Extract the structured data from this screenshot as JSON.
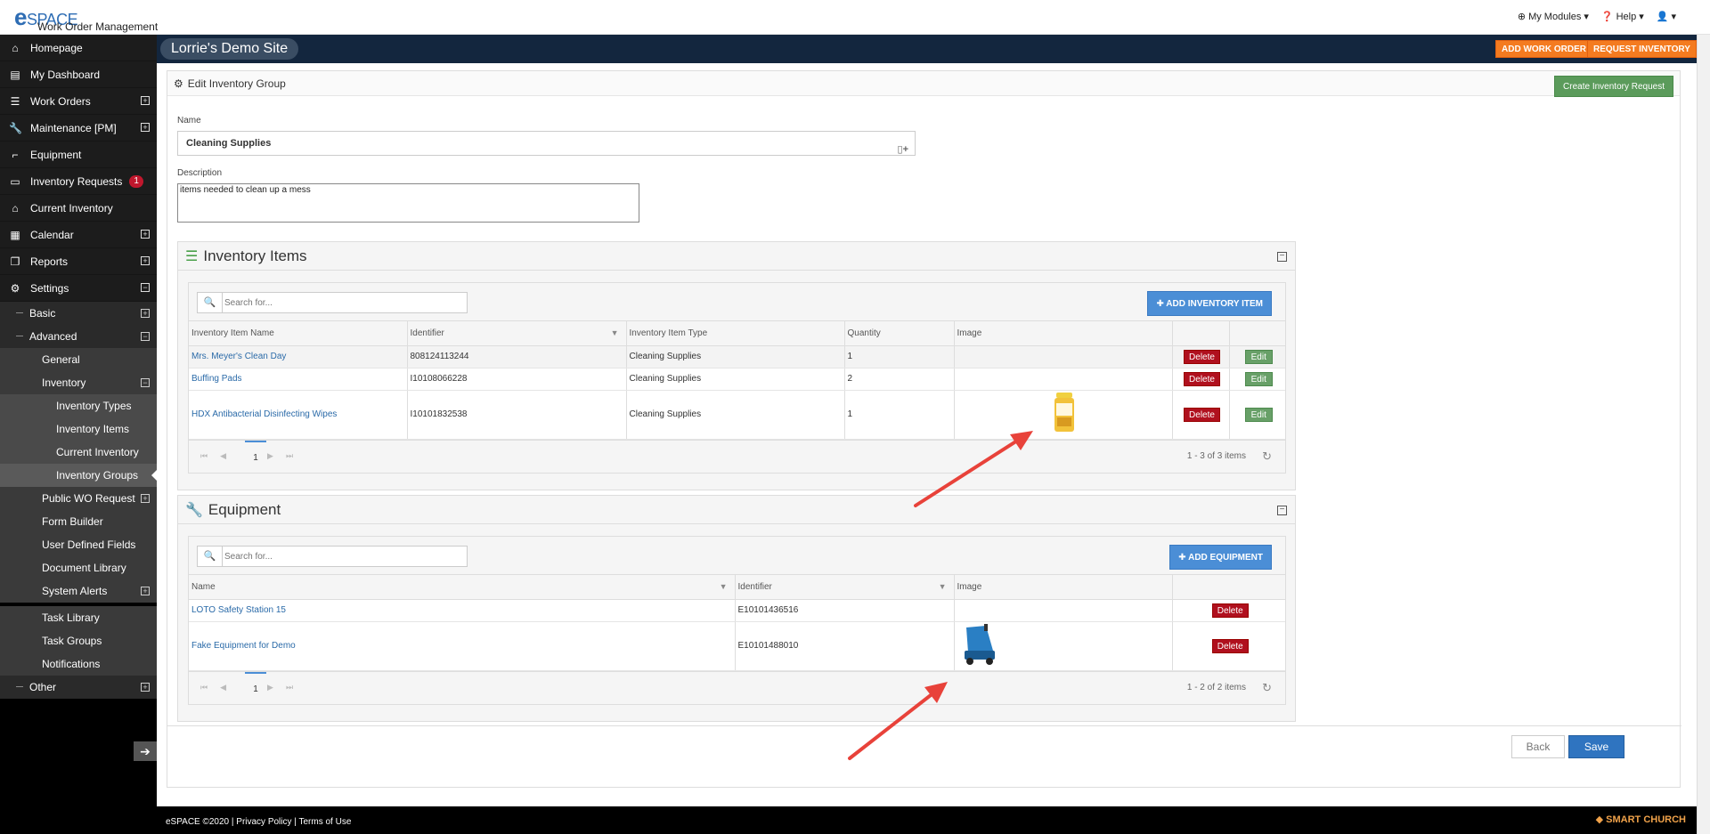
{
  "app": {
    "logo_text": "eSPACE",
    "tagline": "Work Order Management"
  },
  "topnav": {
    "modules": "My Modules",
    "help": "Help",
    "user": ""
  },
  "sidebar": {
    "main": [
      {
        "label": "Homepage",
        "icon": "home-icon"
      },
      {
        "label": "My Dashboard",
        "icon": "dashboard-icon"
      },
      {
        "label": "Work Orders",
        "icon": "list-icon",
        "expand": true
      },
      {
        "label": "Maintenance [PM]",
        "icon": "wrench-icon",
        "expand": true
      },
      {
        "label": "Equipment",
        "icon": "equipment-icon"
      },
      {
        "label": "Inventory Requests",
        "icon": "file-icon",
        "badge": "1"
      },
      {
        "label": "Current Inventory",
        "icon": "bank-icon"
      },
      {
        "label": "Calendar",
        "icon": "calendar-icon",
        "expand": true
      },
      {
        "label": "Reports",
        "icon": "copy-icon",
        "expand": true
      },
      {
        "label": "Settings",
        "icon": "gear-icon",
        "expand": true
      }
    ],
    "settings_sub": {
      "basic": "Basic",
      "advanced": "Advanced",
      "general": "General",
      "inventory": "Inventory",
      "inventory_types": "Inventory Types",
      "inventory_items": "Inventory Items",
      "current_inventory": "Current Inventory",
      "inventory_groups": "Inventory Groups",
      "public_wo": "Public WO Request",
      "form_builder": "Form Builder",
      "udf": "User Defined Fields",
      "doc_library": "Document Library",
      "system_alerts": "System Alerts",
      "task_library": "Task Library",
      "task_groups": "Task Groups",
      "notifications": "Notifications",
      "other": "Other"
    }
  },
  "header": {
    "site": "Lorrie's Demo Site",
    "add_wo": "ADD WORK ORDER",
    "request_inv": "REQUEST INVENTORY"
  },
  "panel": {
    "title": "Edit Inventory Group",
    "create_btn": "Create Inventory Request"
  },
  "form": {
    "name_label": "Name",
    "name_value": "Cleaning Supplies",
    "desc_label": "Description",
    "desc_value": "items needed to clean up a mess"
  },
  "inventory": {
    "title": "Inventory Items",
    "search_placeholder": "Search for...",
    "add_btn": "ADD INVENTORY ITEM",
    "columns": [
      "Inventory Item Name",
      "Identifier",
      "Inventory Item Type",
      "Quantity",
      "Image",
      "",
      ""
    ],
    "rows": [
      {
        "name": "Mrs. Meyer's Clean Day",
        "id": "808124113244",
        "type": "Cleaning Supplies",
        "qty": "1",
        "image": ""
      },
      {
        "name": "Buffing Pads",
        "id": "I10108066228",
        "type": "Cleaning Supplies",
        "qty": "2",
        "image": ""
      },
      {
        "name": "HDX Antibacterial Disinfecting Wipes",
        "id": "I10101832538",
        "type": "Cleaning Supplies",
        "qty": "1",
        "image": "wipes-canister"
      }
    ],
    "delete": "Delete",
    "edit": "Edit",
    "page": "1",
    "info": "1 - 3 of 3 items"
  },
  "equipment": {
    "title": "Equipment",
    "search_placeholder": "Search for...",
    "add_btn": "ADD EQUIPMENT",
    "columns": [
      "Name",
      "Identifier",
      "Image",
      ""
    ],
    "rows": [
      {
        "name": "LOTO Safety Station 15",
        "id": "E10101436516",
        "image": ""
      },
      {
        "name": "Fake Equipment for Demo",
        "id": "E10101488010",
        "image": "floor-scrubber"
      }
    ],
    "delete": "Delete",
    "page": "1",
    "info": "1 - 2 of 2 items"
  },
  "buttons": {
    "back": "Back",
    "save": "Save"
  },
  "footer": {
    "text": "eSPACE ©2020 | Privacy Policy | Terms of Use",
    "brand": "SMART CHURCH"
  },
  "colors": {
    "accent": "#f47b20",
    "header": "#13263e",
    "delete": "#b0101e",
    "edit": "#68a068",
    "primary": "#4b8ed6",
    "arrow": "#e8423a"
  }
}
